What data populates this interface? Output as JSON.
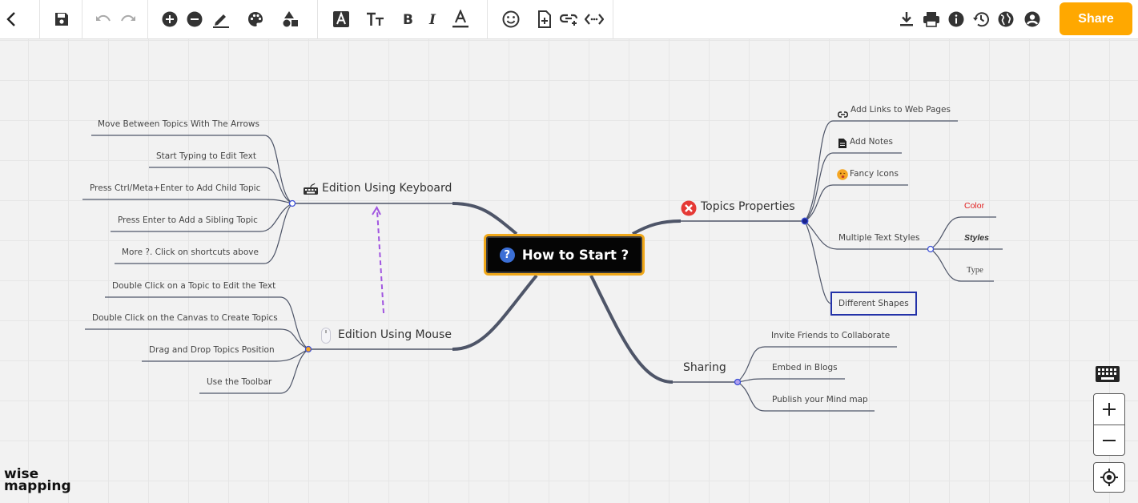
{
  "app": {
    "logo_top": "wise",
    "logo_bottom": "mapping",
    "share_label": "Share",
    "accent_color": "#ffa800"
  },
  "toolbar": {
    "icons": [
      "back-icon",
      "save-icon",
      "undo-icon",
      "redo-icon",
      "add-topic-icon",
      "delete-topic-icon",
      "border-style-icon",
      "palette-icon",
      "shapes-icon",
      "font-icon",
      "font-size-icon",
      "bold-icon",
      "italic-icon",
      "font-color-icon",
      "emoji-icon",
      "note-icon",
      "link-icon",
      "relationship-icon",
      "download-icon",
      "print-icon",
      "info-icon",
      "history-icon",
      "publish-icon",
      "account-icon"
    ]
  },
  "mindmap": {
    "central": "How to Start ?",
    "keyboard": {
      "title": "Edition Using Keyboard",
      "items": [
        "Move Between Topics With The Arrows",
        "Start Typing to Edit Text",
        "Press Ctrl/Meta+Enter to Add Child Topic",
        "Press Enter to Add a Sibling Topic",
        "More ?. Click on shortcuts above"
      ]
    },
    "mouse": {
      "title": "Edition Using Mouse",
      "items": [
        "Double Click on a Topic to Edit the Text",
        "Double Click on the Canvas to Create Topics",
        "Drag and Drop Topics Position",
        "Use the Toolbar"
      ]
    },
    "properties": {
      "title": "Topics Properties",
      "items": [
        "Add Links to Web Pages",
        "Add Notes",
        "Fancy Icons",
        "Multiple Text Styles",
        "Different Shapes"
      ],
      "styles": [
        "Color",
        "Styles",
        "Type"
      ],
      "color_sample": "#e02020",
      "shape_border": "#2332a8"
    },
    "sharing": {
      "title": "Sharing",
      "items": [
        "Invite Friends to Collaborate",
        "Embed in Blogs",
        "Publish your Mind map"
      ]
    }
  },
  "zoom_controls": {
    "keyboard_icon": "keyboard-icon",
    "zoom_in_icon": "zoom-in-icon",
    "zoom_out_icon": "zoom-out-icon",
    "center_icon": "center-focus-icon"
  }
}
